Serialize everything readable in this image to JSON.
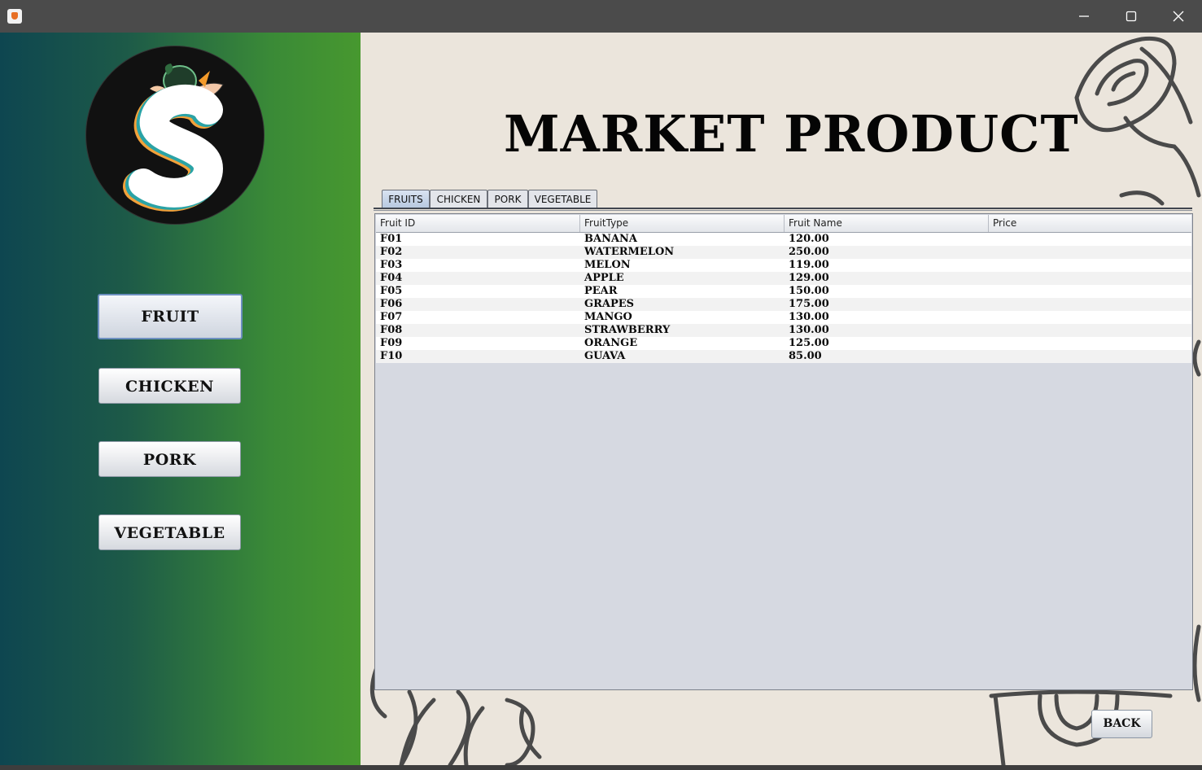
{
  "window": {
    "minimize_icon": "minimize-icon",
    "maximize_icon": "maximize-icon",
    "close_icon": "close-icon"
  },
  "sidebar": {
    "buttons": [
      {
        "label": "FRUIT",
        "active": true
      },
      {
        "label": "CHICKEN",
        "active": false
      },
      {
        "label": "PORK",
        "active": false
      },
      {
        "label": "VEGETABLE",
        "active": false
      }
    ]
  },
  "main": {
    "title": "MARKET PRODUCT",
    "tabs": [
      {
        "label": "FRUITS",
        "active": true
      },
      {
        "label": "CHICKEN",
        "active": false
      },
      {
        "label": "PORK",
        "active": false
      },
      {
        "label": "VEGETABLE",
        "active": false
      }
    ],
    "table": {
      "columns": [
        "Fruit ID",
        "FruitType",
        "Fruit Name",
        "Price"
      ],
      "rows": [
        [
          "F01",
          "BANANA",
          "120.00",
          ""
        ],
        [
          "F02",
          "WATERMELON",
          "250.00",
          ""
        ],
        [
          "F03",
          "MELON",
          "119.00",
          ""
        ],
        [
          "F04",
          "APPLE",
          "129.00",
          ""
        ],
        [
          "F05",
          "PEAR",
          "150.00",
          ""
        ],
        [
          "F06",
          "GRAPES",
          "175.00",
          ""
        ],
        [
          "F07",
          "MANGO",
          "130.00",
          ""
        ],
        [
          "F08",
          "STRAWBERRY",
          "130.00",
          ""
        ],
        [
          "F09",
          "ORANGE",
          "125.00",
          ""
        ],
        [
          "F10",
          "GUAVA",
          "85.00",
          ""
        ]
      ]
    },
    "back_label": "BACK"
  },
  "colors": {
    "sidebar_gradient_start": "#0e4650",
    "sidebar_gradient_end": "#47982f",
    "main_background": "#ebe5dc",
    "titlebar": "#4b4b4b"
  }
}
